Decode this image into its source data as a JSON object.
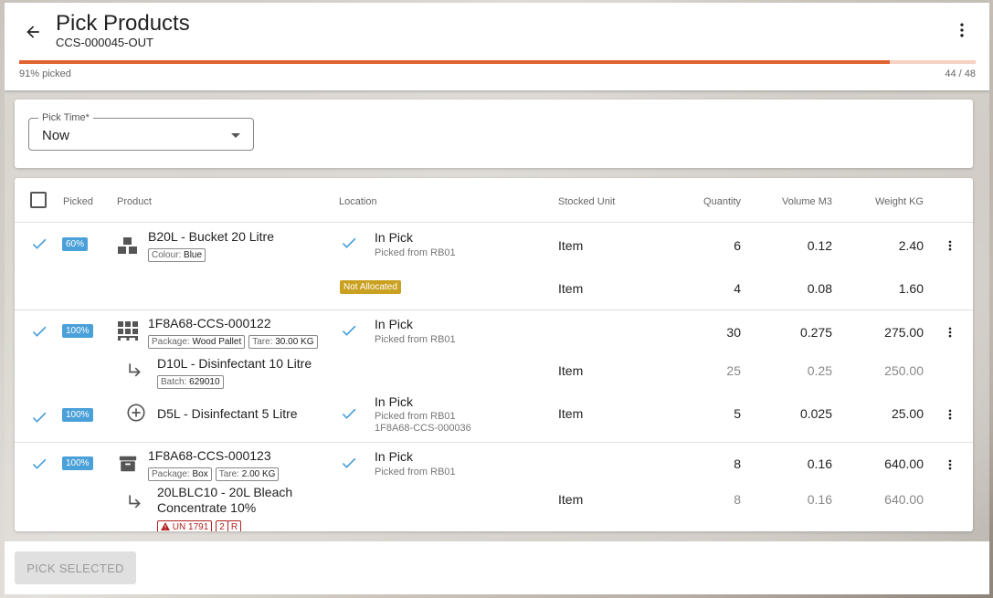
{
  "header": {
    "title": "Pick Products",
    "subtitle": "CCS-000045-OUT",
    "progress_label": "91% picked",
    "progress_count": "44 / 48",
    "progress_fraction": 0.91
  },
  "pick_time": {
    "label": "Pick Time*",
    "value": "Now"
  },
  "table": {
    "columns": {
      "picked": "Picked",
      "product": "Product",
      "location": "Location",
      "stocked_unit": "Stocked Unit",
      "quantity": "Quantity",
      "volume": "Volume M3",
      "weight": "Weight KG"
    },
    "rows": [
      {
        "picked_pct": "60%",
        "product": "B20L - Bucket 20 Litre",
        "attr_key": "Colour:",
        "attr_val": "Blue",
        "loc_main": "In Pick",
        "loc_sub": "Picked from RB01",
        "unit": "Item",
        "qty": "6",
        "vol": "0.12",
        "wt": "2.40"
      },
      {
        "badge": "Not Allocated",
        "unit": "Item",
        "qty": "4",
        "vol": "0.08",
        "wt": "1.60"
      },
      {
        "picked_pct": "100%",
        "product": "1F8A68-CCS-000122",
        "pkg_key": "Package:",
        "pkg_val": "Wood Pallet",
        "tare_key": "Tare:",
        "tare_val": "30.00 KG",
        "loc_main": "In Pick",
        "loc_sub": "Picked from RB01",
        "qty": "30",
        "vol": "0.275",
        "wt": "275.00"
      },
      {
        "product": "D10L - Disinfectant 10 Litre",
        "batch_key": "Batch:",
        "batch_val": "629010",
        "unit": "Item",
        "qty": "25",
        "vol": "0.25",
        "wt": "250.00"
      },
      {
        "picked_pct": "100%",
        "product": "D5L - Disinfectant 5 Litre",
        "loc_main": "In Pick",
        "loc_sub": "Picked from RB01",
        "loc_sub2": "1F8A68-CCS-000036",
        "unit": "Item",
        "qty": "5",
        "vol": "0.025",
        "wt": "25.00"
      },
      {
        "picked_pct": "100%",
        "product": "1F8A68-CCS-000123",
        "pkg_key": "Package:",
        "pkg_val": "Box",
        "tare_key": "Tare:",
        "tare_val": "2.00 KG",
        "loc_main": "In Pick",
        "loc_sub": "Picked from RB01",
        "qty": "8",
        "vol": "0.16",
        "wt": "640.00"
      },
      {
        "product_line1": "20LBLC10 - 20L Bleach",
        "product_line2": "Concentrate 10%",
        "un_chip": "UN 1791",
        "class_a": "2",
        "class_b": "R",
        "unit": "Item",
        "qty": "8",
        "vol": "0.16",
        "wt": "640.00"
      }
    ]
  },
  "footer": {
    "pick_button": "PICK SELECTED"
  },
  "colors": {
    "accent": "#e0622f",
    "check_blue": "#4aa0d8",
    "badge_gold": "#c9a01f",
    "hazard_red": "#b32020"
  },
  "icons": {
    "back": "arrow-left-icon",
    "more": "more-vertical-icon",
    "check": "check-icon",
    "boxes": "boxes-icon",
    "pallet": "pallet-icon",
    "sub_arrow": "subdirectory-arrow-icon",
    "add_circle": "add-circle-icon",
    "archive": "archive-box-icon",
    "warning": "warning-icon"
  }
}
